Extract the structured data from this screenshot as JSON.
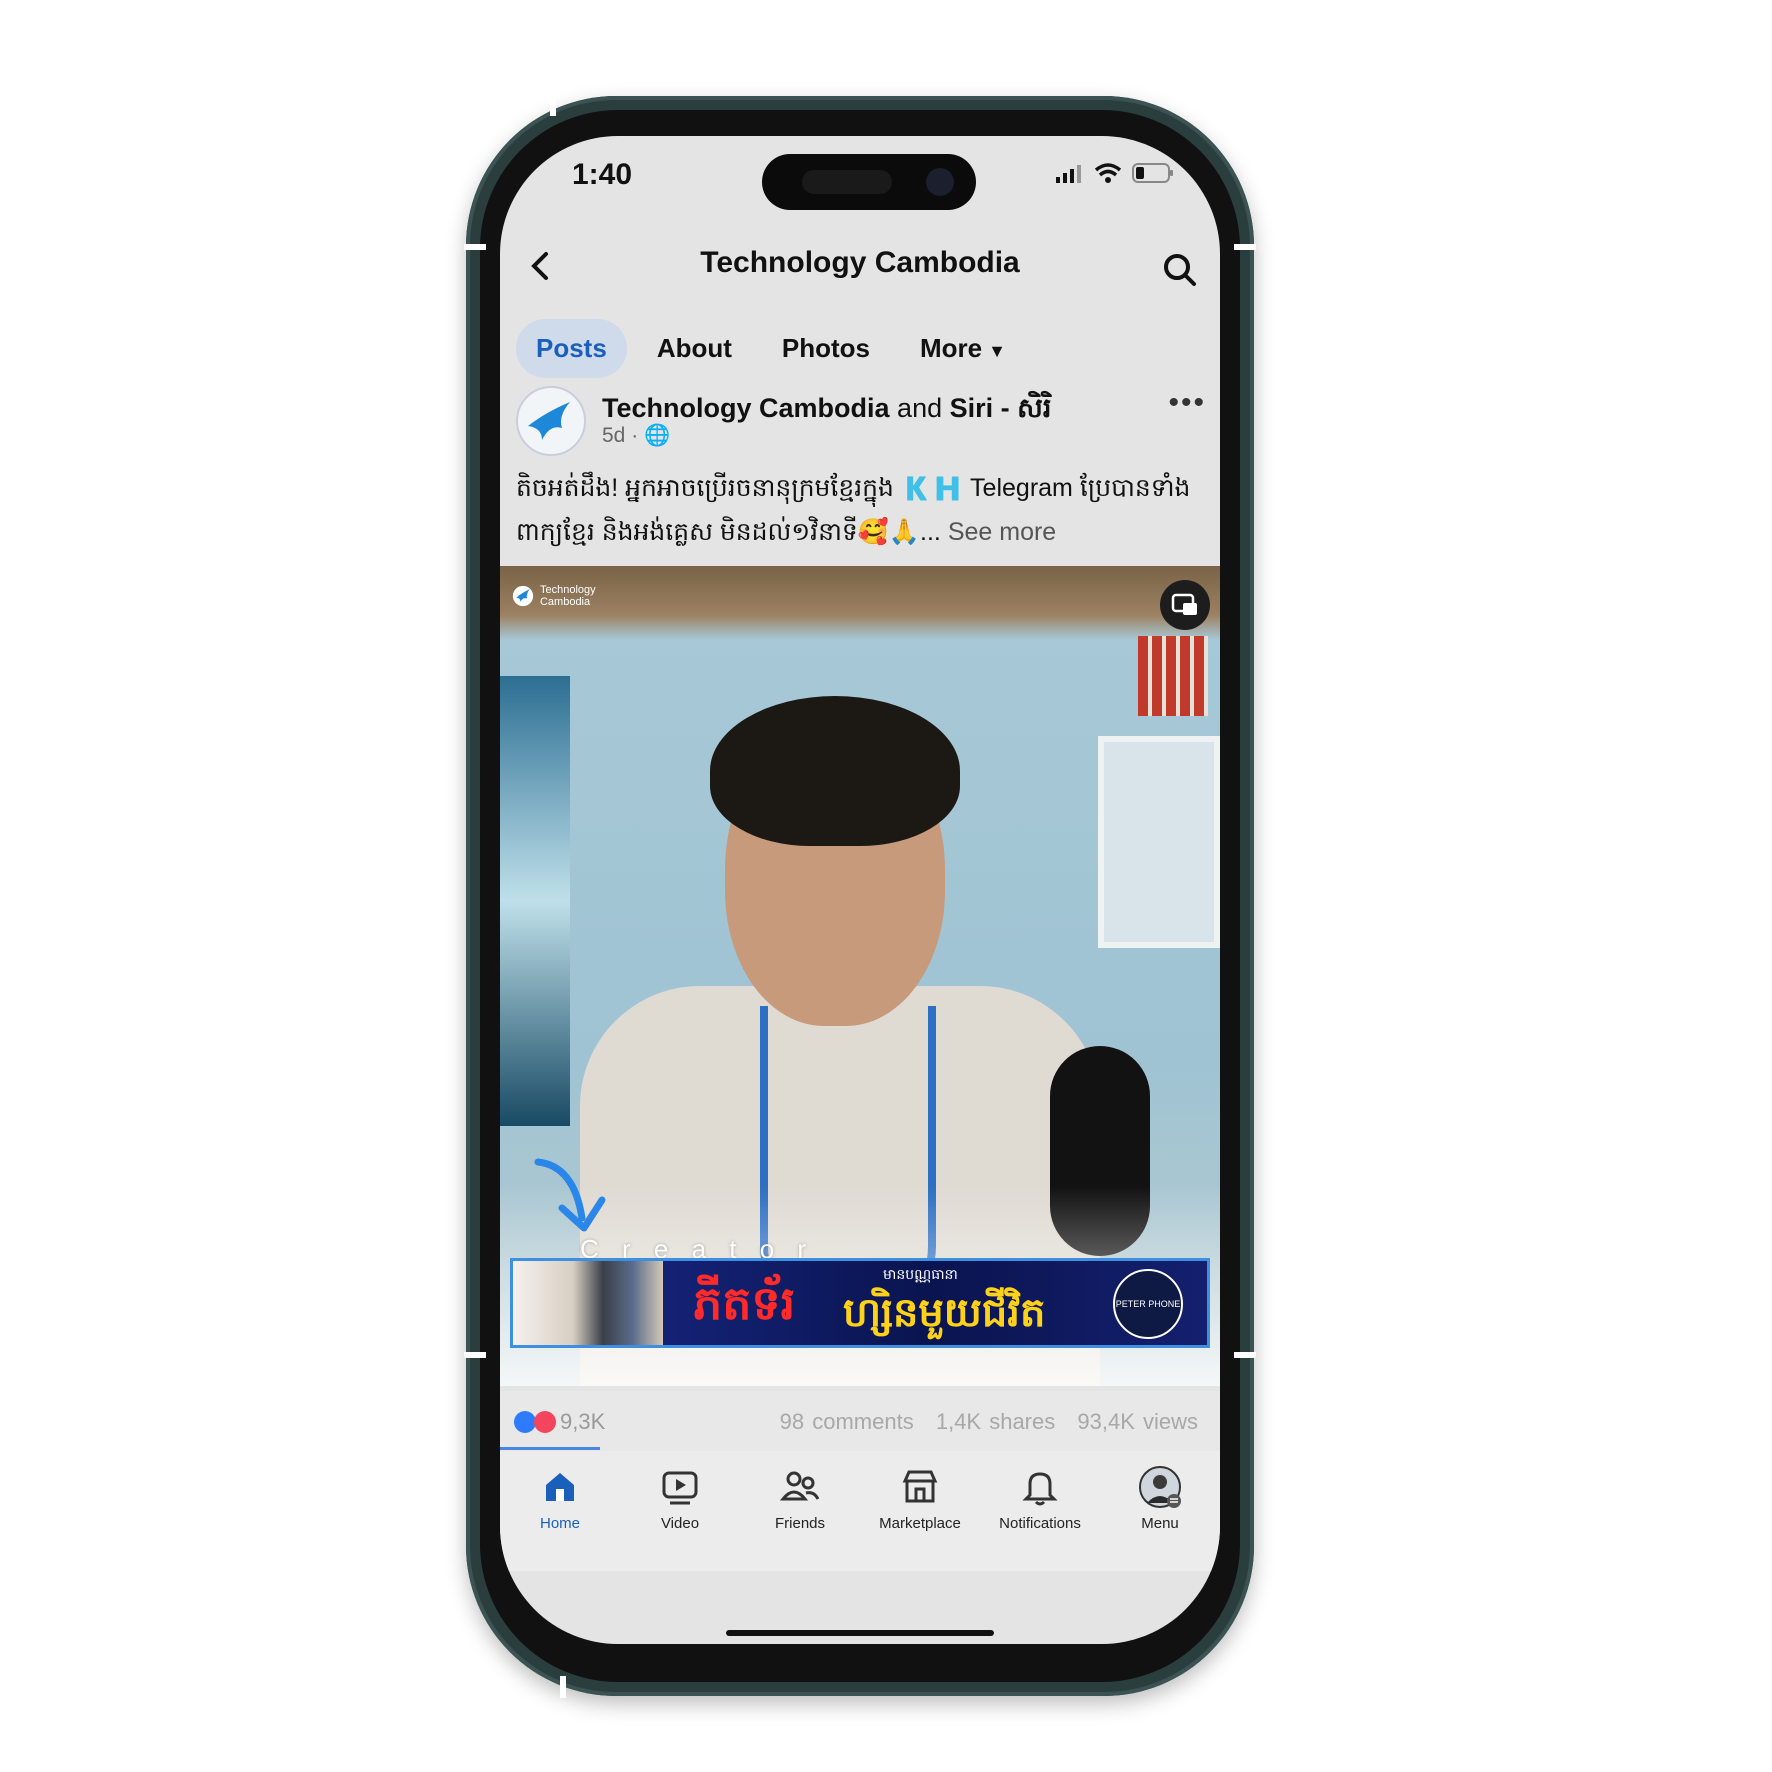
{
  "status": {
    "time": "1:40"
  },
  "header": {
    "title": "Technology Cambodia"
  },
  "tabs": [
    {
      "label": "Posts",
      "active": true
    },
    {
      "label": "About"
    },
    {
      "label": "Photos"
    },
    {
      "label": "More"
    }
  ],
  "post": {
    "author_name": "Technology Cambodia",
    "author_and": "and",
    "author_second": "Siri",
    "author_suffix": "- សិរិ",
    "age": "5d",
    "caption_line1": "តិចអត់ដឹង! អ្នកអាចប្រើរចនានុក្រមខ្មែរក្នុង 🇰🇭 Telegram ប្រែបានទាំង",
    "caption_line2": "ពាក្យខ្មែរ និងអង់គ្លេស មិនដល់១វិនាទី🥰🙏...",
    "see_more": "See more"
  },
  "video": {
    "brand": "Technology Cambodia",
    "creator_text": "C  r e a t o r",
    "ad_main": "ភីតទ័រ",
    "ad_sub": "ហ្សិនមួយជីវិត",
    "ad_small": "មានបណ្ណធានា",
    "ad_logo": "PETER PHONE"
  },
  "stats": {
    "reactions": "9,3K",
    "comments": "98 comments",
    "shares": "1,4K shares",
    "views": "93,4K views"
  },
  "nav": {
    "home": "Home",
    "video": "Video",
    "friends": "Friends",
    "marketplace": "Marketplace",
    "notifications": "Notifications",
    "menu": "Menu"
  },
  "colors": {
    "accent": "#1b5fbd",
    "frame": "#2a3e3e",
    "tab_active_bg": "#cfdbea"
  }
}
